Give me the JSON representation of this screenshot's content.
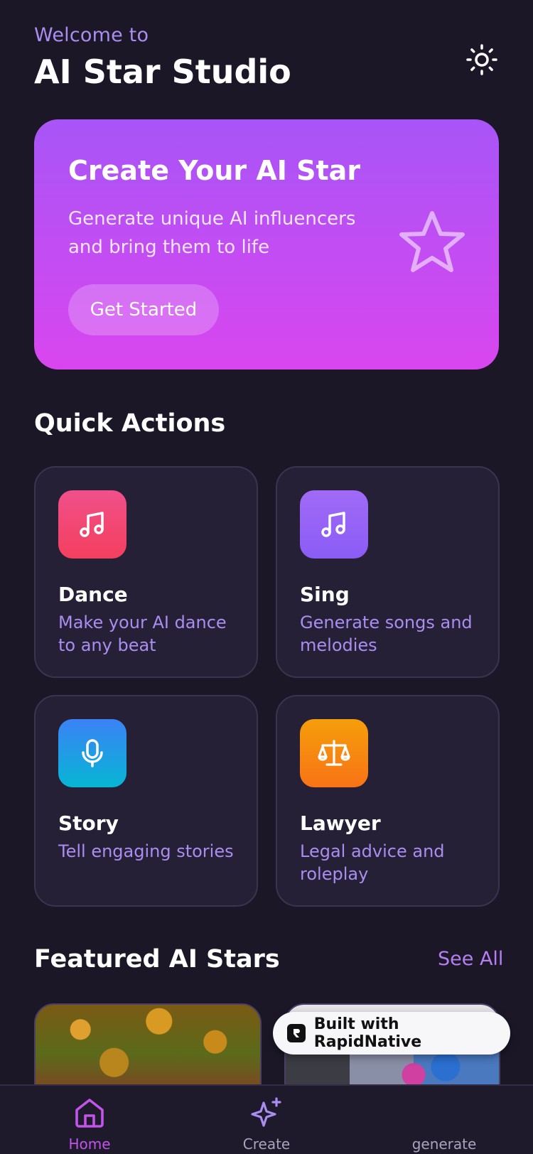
{
  "header": {
    "welcome": "Welcome to",
    "title": "AI Star Studio",
    "theme_icon": "sun-icon"
  },
  "hero": {
    "title": "Create Your AI Star",
    "subtitle": "Generate unique AI influencers and bring them to life",
    "button": "Get Started",
    "icon": "star-icon"
  },
  "quick_actions": {
    "title": "Quick Actions",
    "items": [
      {
        "title": "Dance",
        "desc": "Make your AI dance to any beat",
        "icon": "music-note-icon",
        "color": "#f43f5e"
      },
      {
        "title": "Sing",
        "desc": "Generate songs and melodies",
        "icon": "music-note-icon",
        "color": "#8b5cf6"
      },
      {
        "title": "Story",
        "desc": "Tell engaging stories",
        "icon": "microphone-icon",
        "color": "#0ea5e9"
      },
      {
        "title": "Lawyer",
        "desc": "Legal advice and roleplay",
        "icon": "scale-icon",
        "color": "#f97316"
      }
    ]
  },
  "featured": {
    "title": "Featured AI Stars",
    "see_all": "See All"
  },
  "badge": {
    "text": "Built with RapidNative"
  },
  "tabs": [
    {
      "label": "Home",
      "icon": "home-icon",
      "active": true
    },
    {
      "label": "Create",
      "icon": "sparkle-icon",
      "active": false
    },
    {
      "label": "generate",
      "icon": "",
      "active": false
    }
  ],
  "colors": {
    "background": "#1b1727",
    "accent": "#a855f7",
    "active_tab": "#c254e8"
  }
}
